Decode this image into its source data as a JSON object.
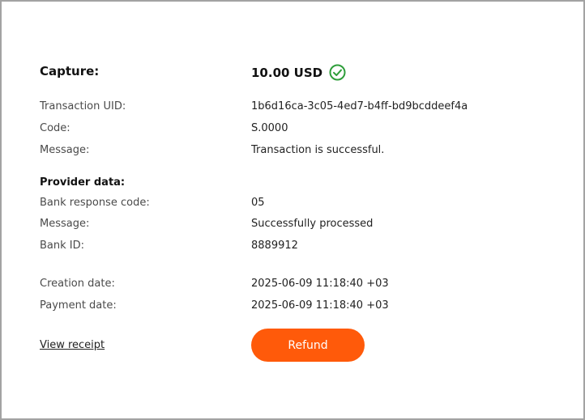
{
  "capture": {
    "label": "Capture:",
    "amount": "10.00 USD",
    "status_icon": "check-circle-icon",
    "status_color": "#2e9e3a"
  },
  "transaction": [
    {
      "label": "Transaction UID:",
      "value": "1b6d16ca-3c05-4ed7-b4ff-bd9bcddeef4a"
    },
    {
      "label": "Code:",
      "value": "S.0000"
    },
    {
      "label": "Message:",
      "value": "Transaction is successful."
    }
  ],
  "provider": {
    "title": "Provider data:",
    "rows": [
      {
        "label": "Bank response code:",
        "value": "05"
      },
      {
        "label": "Message:",
        "value": "Successfully processed"
      },
      {
        "label": "Bank ID:",
        "value": "8889912"
      }
    ]
  },
  "dates": [
    {
      "label": "Creation date:",
      "value": "2025-06-09 11:18:40 +03"
    },
    {
      "label": "Payment date:",
      "value": "2025-06-09 11:18:40 +03"
    }
  ],
  "actions": {
    "view_receipt": "View receipt",
    "refund": "Refund",
    "accent_color": "#ff5a0a"
  }
}
